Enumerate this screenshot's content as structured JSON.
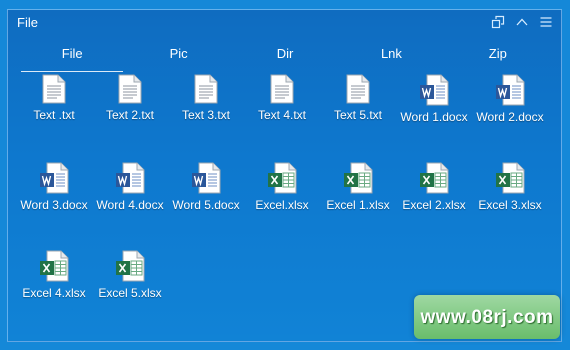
{
  "window": {
    "title": "File"
  },
  "titlebar": {
    "icons": [
      "restore-window-icon",
      "collapse-up-icon",
      "menu-icon"
    ]
  },
  "tabs": [
    {
      "label": "File",
      "active": true
    },
    {
      "label": "Pic",
      "active": false
    },
    {
      "label": "Dir",
      "active": false
    },
    {
      "label": "Lnk",
      "active": false
    },
    {
      "label": "Zip",
      "active": false
    }
  ],
  "files": [
    {
      "name": "Text .txt",
      "type": "txt"
    },
    {
      "name": "Text 2.txt",
      "type": "txt"
    },
    {
      "name": "Text 3.txt",
      "type": "txt"
    },
    {
      "name": "Text 4.txt",
      "type": "txt"
    },
    {
      "name": "Text 5.txt",
      "type": "txt"
    },
    {
      "name": "Word 1.docx",
      "type": "word"
    },
    {
      "name": "Word 2.docx",
      "type": "word"
    },
    {
      "name": "Word 3.docx",
      "type": "word"
    },
    {
      "name": "Word 4.docx",
      "type": "word"
    },
    {
      "name": "Word 5.docx",
      "type": "word"
    },
    {
      "name": "Excel.xlsx",
      "type": "excel"
    },
    {
      "name": "Excel 1.xlsx",
      "type": "excel"
    },
    {
      "name": "Excel 2.xlsx",
      "type": "excel"
    },
    {
      "name": "Excel 3.xlsx",
      "type": "excel"
    },
    {
      "name": "Excel 4.xlsx",
      "type": "excel"
    },
    {
      "name": "Excel 5.xlsx",
      "type": "excel"
    }
  ],
  "watermark": {
    "text": "www.08rj.com"
  },
  "colors": {
    "word": "#2b579a",
    "excel": "#217346",
    "background": "#1588d8"
  }
}
